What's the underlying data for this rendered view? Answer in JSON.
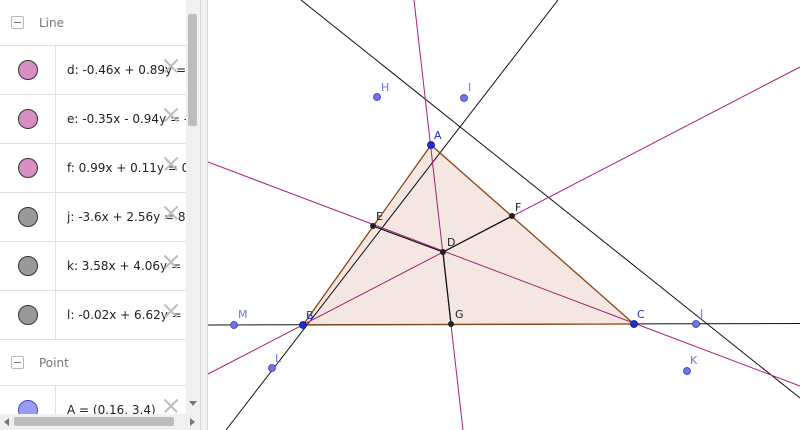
{
  "algebra": {
    "sections": {
      "line": "Line",
      "point": "Point"
    },
    "lines": [
      {
        "text": "d: -0.46x + 0.89y = ",
        "color": "#d98fc4"
      },
      {
        "text": "e: -0.35x - 0.94y = -",
        "color": "#d98fc4"
      },
      {
        "text": "f: 0.99x + 0.11y = 0",
        "color": "#d98fc4"
      },
      {
        "text": "j: -3.6x + 2.56y = 8",
        "color": "#999999"
      },
      {
        "text": "k: 3.58x + 4.06y = ",
        "color": "#999999"
      },
      {
        "text": "l: -0.02x + 6.62y = ",
        "color": "#999999"
      }
    ],
    "points": [
      {
        "text": "A = (0.16, 3.4)",
        "color": "#9a9cf7"
      }
    ]
  },
  "construction": {
    "labels": {
      "A": "A",
      "B": "B",
      "C": "C",
      "D": "D",
      "E": "E",
      "F": "F",
      "G": "G",
      "H": "H",
      "I": "I",
      "J": "J",
      "K": "K",
      "L": "L",
      "M": "M"
    },
    "colors": {
      "triangle_fill": "#f4e6e0",
      "triangle_edge": "#8b4513",
      "line_black": "#111111",
      "line_magenta": "#a0227a",
      "point_blue": "#1b2dd6",
      "point_light": "#6f74e8",
      "point_dark": "#222222"
    }
  }
}
